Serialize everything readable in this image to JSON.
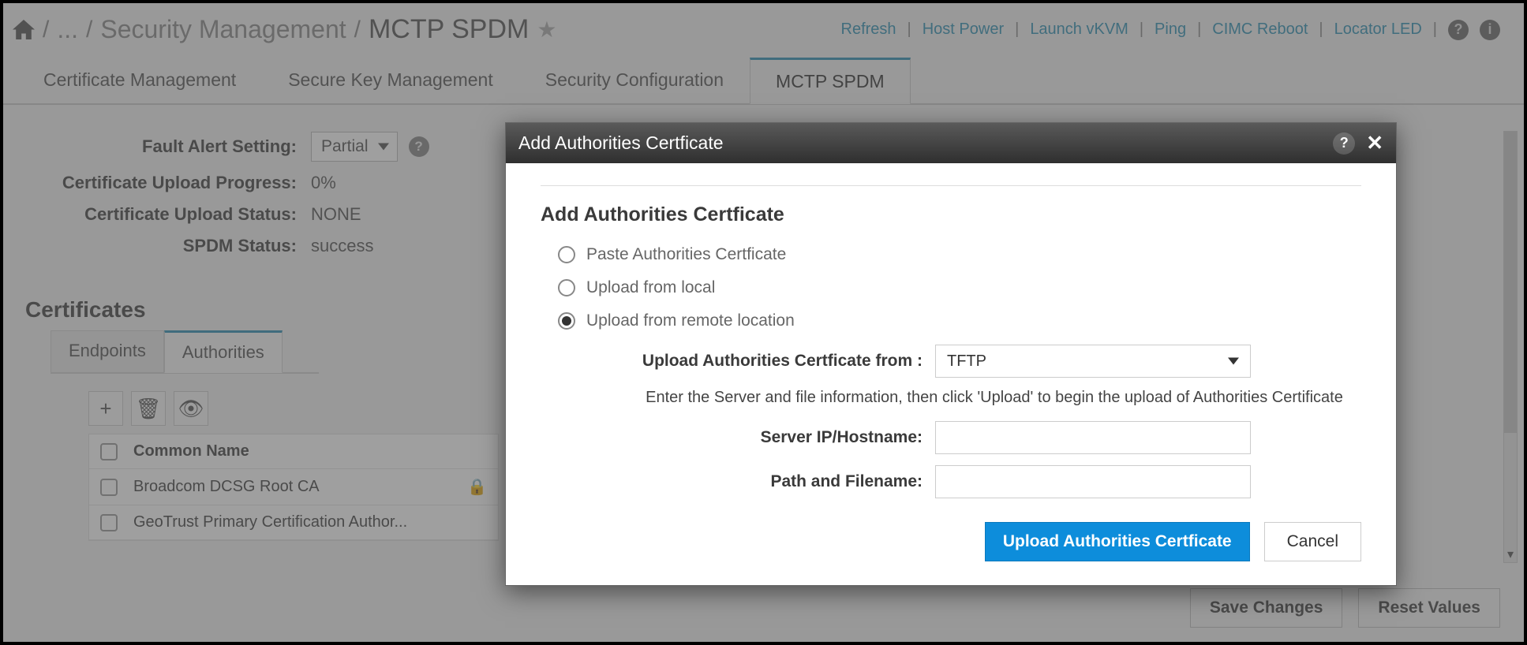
{
  "breadcrumb": {
    "ellipsis": "...",
    "parent": "Security Management",
    "current": "MCTP SPDM"
  },
  "actions": [
    "Refresh",
    "Host Power",
    "Launch vKVM",
    "Ping",
    "CIMC Reboot",
    "Locator LED"
  ],
  "main_tabs": [
    "Certificate Management",
    "Secure Key Management",
    "Security Configuration",
    "MCTP SPDM"
  ],
  "status": {
    "fault_alert_label": "Fault Alert Setting:",
    "fault_alert_value": "Partial",
    "upload_progress_label": "Certificate Upload Progress:",
    "upload_progress_value": "0%",
    "upload_status_label": "Certificate Upload Status:",
    "upload_status_value": "NONE",
    "spdm_status_label": "SPDM Status:",
    "spdm_status_value": "success"
  },
  "certs": {
    "title": "Certificates",
    "subtabs": [
      "Endpoints",
      "Authorities"
    ],
    "col_header": "Common Name",
    "rows": [
      "Broadcom DCSG Root CA",
      "GeoTrust Primary Certification Author..."
    ]
  },
  "footer": {
    "save": "Save Changes",
    "reset": "Reset Values"
  },
  "modal": {
    "title": "Add Authorities Certficate",
    "heading": "Add Authorities Certficate",
    "opt_paste": "Paste Authorities Certficate",
    "opt_local": "Upload from local",
    "opt_remote": "Upload from remote location",
    "from_label": "Upload Authorities Certficate from :",
    "from_value": "TFTP",
    "hint": "Enter the Server and file information, then click 'Upload' to begin the upload of Authorities Certificate",
    "server_label": "Server IP/Hostname:",
    "path_label": "Path and Filename:",
    "upload_btn": "Upload Authorities Certficate",
    "cancel_btn": "Cancel"
  }
}
